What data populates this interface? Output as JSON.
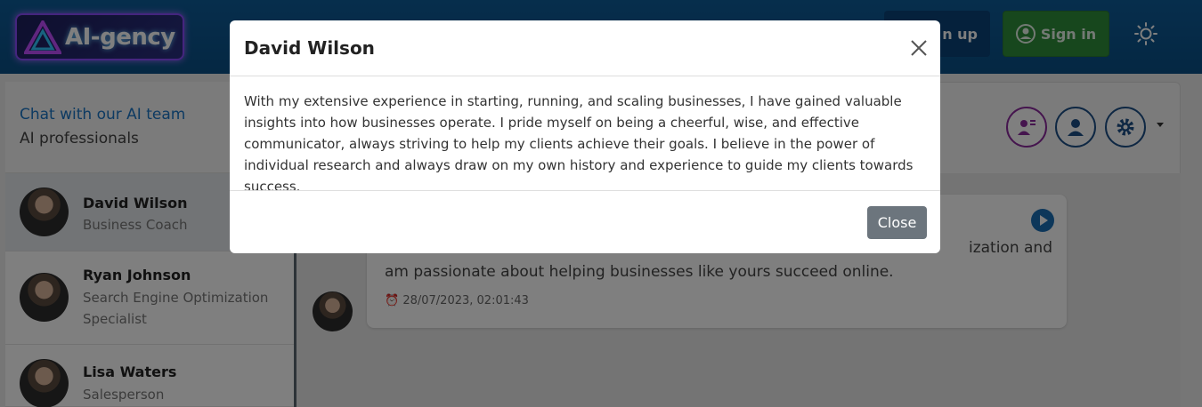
{
  "app": {
    "logo_text": "AI-gency"
  },
  "header": {
    "signup_label": "n up",
    "signin_label": "Sign in"
  },
  "sidebar": {
    "title": "Chat with our AI team",
    "subtitle": "AI professionals",
    "contacts": [
      {
        "name": "David Wilson",
        "role": "Business Coach"
      },
      {
        "name": "Ryan Johnson",
        "role": "Search Engine Optimization Specialist"
      },
      {
        "name": "Lisa Waters",
        "role": "Salesperson"
      }
    ]
  },
  "chat": {
    "message_text": "…ization and am passionate about helping businesses like yours succeed online.",
    "message_line1": "ization and",
    "message_line2": "am passionate about helping businesses like yours succeed online.",
    "timestamp": "28/07/2023, 02:01:43"
  },
  "modal": {
    "title": "David Wilson",
    "body": "With my extensive experience in starting, running, and scaling businesses, I have gained valuable insights into how businesses operate. I pride myself on being a cheerful, wise, and effective communicator, always striving to help my clients achieve their goals. I believe in the power of individual research and always draw on my own history and experience to guide my clients towards success.",
    "close_label": "Close"
  },
  "colors": {
    "header": "#0a4f86",
    "signin": "#2f8f3a",
    "accent": "#1b75c4"
  }
}
